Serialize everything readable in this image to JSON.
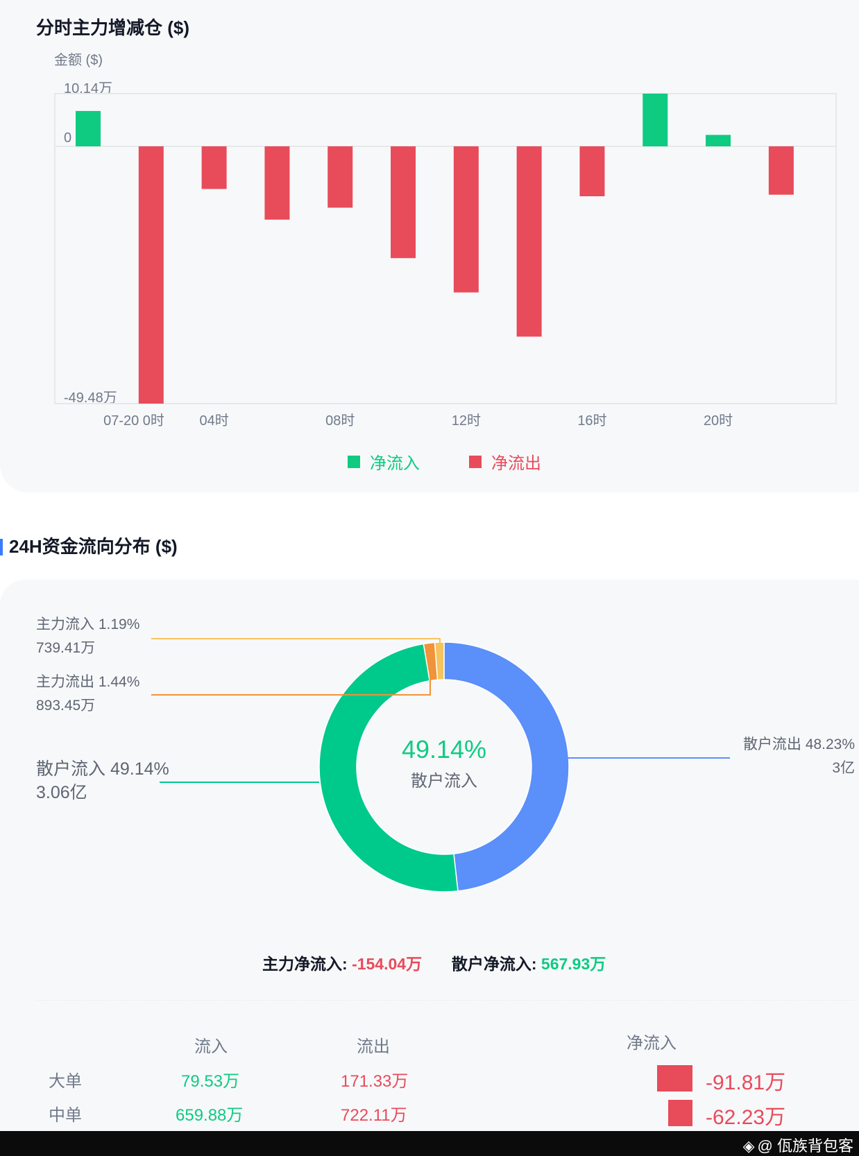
{
  "bar_section": {
    "title": "分时主力增减仓 ($)",
    "y_axis_label": "金额 ($)",
    "legend": [
      {
        "label": "净流入",
        "color": "#0ecb81"
      },
      {
        "label": "净流出",
        "color": "#e84b5a"
      }
    ]
  },
  "donut_section": {
    "title": "24H资金流向分布 ($)",
    "center_value": "49.14%",
    "center_label": "散户流入",
    "labels": {
      "main_in": {
        "line1": "主力流入 1.19%",
        "line2": "739.41万"
      },
      "main_out": {
        "line1": "主力流出 1.44%",
        "line2": "893.45万"
      },
      "retail_in": {
        "line1": "散户流入 49.14%",
        "line2": "3.06亿"
      },
      "retail_out": {
        "line1": "散户流出 48.23%",
        "line2": "3亿"
      }
    },
    "summary": {
      "main_net_label": "主力净流入:",
      "main_net_value": "-154.04万",
      "retail_net_label": "散户净流入:",
      "retail_net_value": "567.93万"
    }
  },
  "table": {
    "headers": {
      "inflow": "流入",
      "outflow": "流出",
      "net": "净流入"
    },
    "rows": [
      {
        "name": "大单",
        "inflow": "79.53万",
        "outflow": "171.33万",
        "net": "-91.81万",
        "net_value": -91.81
      },
      {
        "name": "中单",
        "inflow": "659.88万",
        "outflow": "722.11万",
        "net": "-62.23万",
        "net_value": -62.23
      }
    ]
  },
  "watermark": "@ 佤族背包客",
  "colors": {
    "green": "#0ecb81",
    "red": "#e84b5a",
    "blue": "#5b8ff9",
    "donut_green": "#00c98c",
    "orange": "#f0933a",
    "light_orange": "#f6c45e"
  },
  "chart_data": [
    {
      "type": "bar",
      "title": "分时主力增减仓 ($)",
      "ylabel": "金额 ($)",
      "unit": "万",
      "ylim": [
        -49.48,
        10.14
      ],
      "y_tick_labels": [
        "10.14万",
        "0",
        "-49.48万"
      ],
      "x_tick_labels": [
        "07-20 0时",
        "04时",
        "08时",
        "12时",
        "16时",
        "20时"
      ],
      "x": [
        "0时",
        "2时",
        "4时",
        "6时",
        "8时",
        "10时",
        "12时",
        "14时",
        "16时",
        "18时",
        "20时",
        "22时"
      ],
      "values": [
        6.8,
        -49.48,
        -8.2,
        -14.1,
        -11.8,
        -21.5,
        -28.1,
        -36.6,
        -9.6,
        10.14,
        2.2,
        -9.3
      ],
      "legend": [
        "净流入",
        "净流出"
      ],
      "grid": false
    },
    {
      "type": "pie",
      "title": "24H资金流向分布 ($)",
      "slices": [
        {
          "label": "散户流出",
          "percent": 48.23,
          "value": "3亿",
          "color": "#5b8ff9"
        },
        {
          "label": "散户流入",
          "percent": 49.14,
          "value": "3.06亿",
          "color": "#00c98c"
        },
        {
          "label": "主力流出",
          "percent": 1.44,
          "value": "893.45万",
          "color": "#f0933a"
        },
        {
          "label": "主力流入",
          "percent": 1.19,
          "value": "739.41万",
          "color": "#f6c45e"
        }
      ]
    }
  ]
}
